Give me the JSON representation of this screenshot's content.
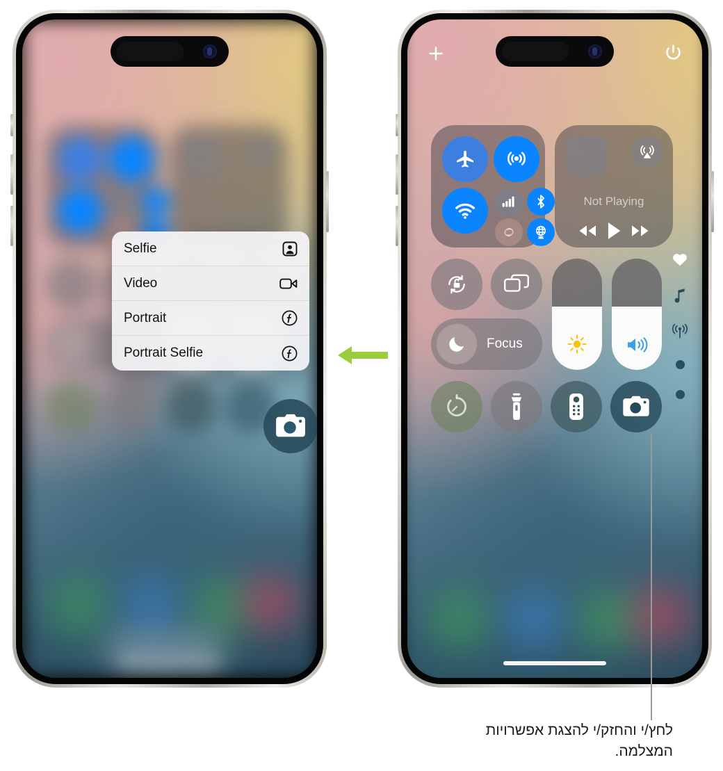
{
  "caption": {
    "text": "לחץ/י והחזק/י להצגת אפשרויות המצלמה."
  },
  "arrow": {
    "name": "left-arrow",
    "color": "#9ACD3C",
    "direction": "left"
  },
  "left_phone": {
    "name": "iphone-context-menu",
    "context_menu": {
      "items": [
        {
          "label": "Selfie",
          "icon": "selfie-icon"
        },
        {
          "label": "Video",
          "icon": "video-camera-icon"
        },
        {
          "label": "Portrait",
          "icon": "portrait-f-icon"
        },
        {
          "label": "Portrait Selfie",
          "icon": "portrait-f-icon"
        }
      ]
    },
    "highlighted_control": {
      "label": "Camera",
      "icon": "camera-icon"
    }
  },
  "right_phone": {
    "name": "iphone-control-center",
    "top_bar": {
      "add_control": {
        "label": "+",
        "icon": "plus-icon"
      },
      "power": {
        "label": "",
        "icon": "power-icon"
      }
    },
    "connectivity": {
      "airplane": {
        "label": "Airplane Mode",
        "icon": "airplane-icon",
        "state": "off"
      },
      "airdrop": {
        "label": "AirDrop",
        "icon": "airdrop-icon",
        "state": "on"
      },
      "wifi": {
        "label": "Wi-Fi",
        "icon": "wifi-icon",
        "state": "on"
      },
      "cellular": {
        "label": "Cellular",
        "icon": "cellular-bars-icon",
        "state": "off"
      },
      "bluetooth": {
        "label": "Bluetooth",
        "icon": "bluetooth-icon",
        "state": "on"
      },
      "hotspot": {
        "label": "Personal Hotspot",
        "icon": "hotspot-icon",
        "state": "off"
      },
      "vpn": {
        "label": "VPN",
        "icon": "vpn-globe-icon",
        "state": "on"
      }
    },
    "media": {
      "status": "Not Playing",
      "airplay": {
        "label": "AirPlay",
        "icon": "airplay-audio-icon"
      },
      "controls": [
        {
          "label": "Rewind",
          "icon": "rewind-icon"
        },
        {
          "label": "Play",
          "icon": "play-icon"
        },
        {
          "label": "Forward",
          "icon": "fast-forward-icon"
        }
      ]
    },
    "toggles": {
      "rotation_lock": {
        "label": "Rotation Lock",
        "icon": "rotation-lock-icon"
      },
      "screen_mirroring": {
        "label": "Screen Mirroring",
        "icon": "screen-mirroring-icon"
      },
      "focus": {
        "label": "Focus",
        "icon": "moon-icon"
      }
    },
    "sliders": {
      "brightness": {
        "label": "Brightness",
        "icon": "sun-icon",
        "value": 57
      },
      "volume": {
        "label": "Volume",
        "icon": "speaker-icon",
        "value": 57
      }
    },
    "quick_actions": [
      {
        "label": "Timer",
        "icon": "timer-icon"
      },
      {
        "label": "Flashlight",
        "icon": "flashlight-icon"
      },
      {
        "label": "Apple TV Remote",
        "icon": "tv-remote-icon"
      },
      {
        "label": "Camera",
        "icon": "camera-icon"
      }
    ],
    "page_indicators": [
      {
        "label": "Home",
        "icon": "heart-icon",
        "active": true
      },
      {
        "label": "Now Playing",
        "icon": "music-note-icon",
        "active": false
      },
      {
        "label": "Connectivity",
        "icon": "antenna-icon",
        "active": false
      },
      {
        "label": "Page 4",
        "icon": "dot-icon",
        "active": false
      },
      {
        "label": "Page 5",
        "icon": "dot-icon",
        "active": false
      }
    ]
  }
}
